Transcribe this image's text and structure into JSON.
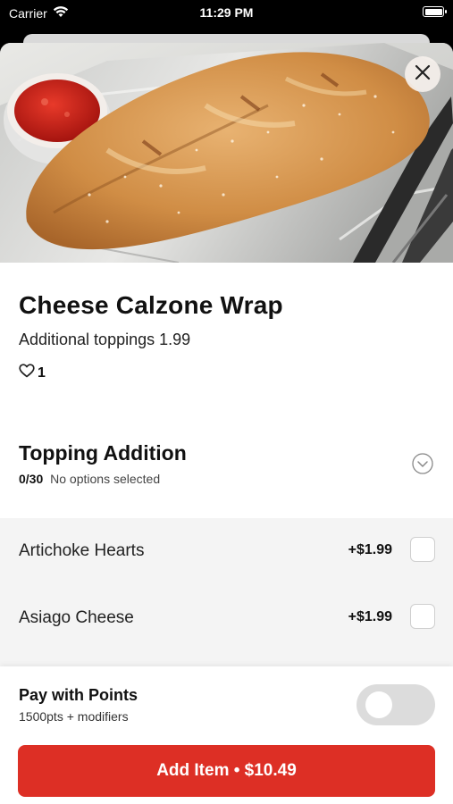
{
  "status_bar": {
    "carrier": "Carrier",
    "time": "11:29 PM"
  },
  "item": {
    "title": "Cheese Calzone Wrap",
    "subtitle": "Additional toppings 1.99",
    "likes": "1"
  },
  "section": {
    "title": "Topping Addition",
    "count": "0/30",
    "status": "No options selected"
  },
  "options": [
    {
      "label": "Artichoke Hearts",
      "price": "+$1.99",
      "checked": false
    },
    {
      "label": "Asiago Cheese",
      "price": "+$1.99",
      "checked": false
    }
  ],
  "points": {
    "title": "Pay with Points",
    "subtitle": "1500pts + modifiers",
    "enabled": false
  },
  "add_button": {
    "label": "Add Item • $10.49"
  },
  "colors": {
    "accent": "#dd2f25",
    "option_bg": "#f4f4f4",
    "toggle_off": "#dcdcdc"
  }
}
